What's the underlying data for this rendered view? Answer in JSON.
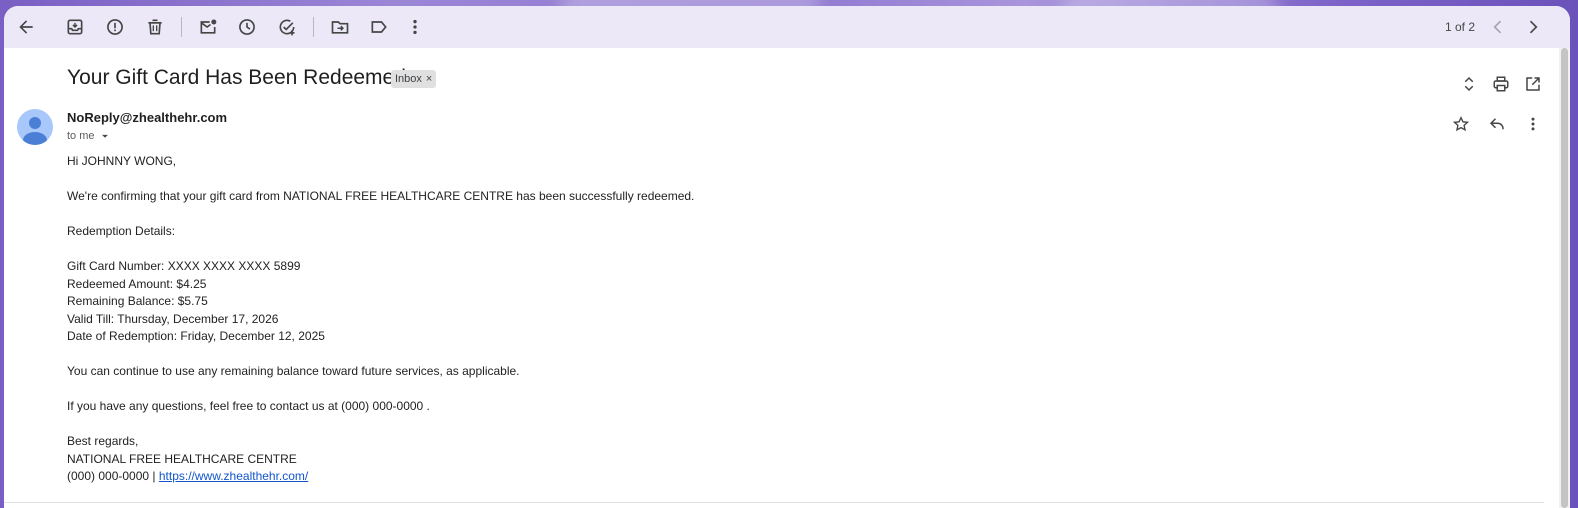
{
  "toolbar": {
    "pager_text": "1 of 2",
    "icons": [
      "back-arrow-icon",
      "archive-icon",
      "report-spam-icon",
      "delete-icon",
      "mark-unread-icon",
      "snooze-icon",
      "add-task-icon",
      "move-to-icon",
      "label-icon",
      "more-vert-icon",
      "chevron-left-icon",
      "chevron-right-icon"
    ]
  },
  "email": {
    "subject": "Your Gift Card Has Been Redeemed",
    "label": "Inbox",
    "label_close": "×",
    "sender": "NoReply@zhealthehr.com",
    "recipient": "to me",
    "body": {
      "greeting": "Hi JOHNNY WONG,",
      "intro": "We're confirming that your gift card from NATIONAL FREE HEALTHCARE CENTRE has been successfully redeemed.",
      "details_heading": "Redemption Details:",
      "card_number": "Gift Card Number: XXXX XXXX XXXX 5899",
      "redeemed_amount": "Redeemed Amount: $4.25",
      "remaining_balance": "Remaining Balance: $5.75",
      "valid_till": "Valid Till: Thursday, December 17, 2026",
      "redemption_date": "Date of Redemption: Friday, December 12, 2025",
      "continue_text": "You can continue to use any remaining balance toward future services, as applicable.",
      "questions_text": "If you have any questions, feel free to contact us at (000) 000-0000 .",
      "signoff": "Best regards,",
      "org_name": "NATIONAL FREE HEALTHCARE CENTRE",
      "phone_prefix": "(000) 000-0000 | ",
      "website": "https://www.zhealthehr.com/"
    }
  },
  "colors": {
    "link": "#1155cc",
    "avatar_bg": "#a8c7fa",
    "avatar_fg": "#4b7fd6",
    "icon": "#444746"
  }
}
